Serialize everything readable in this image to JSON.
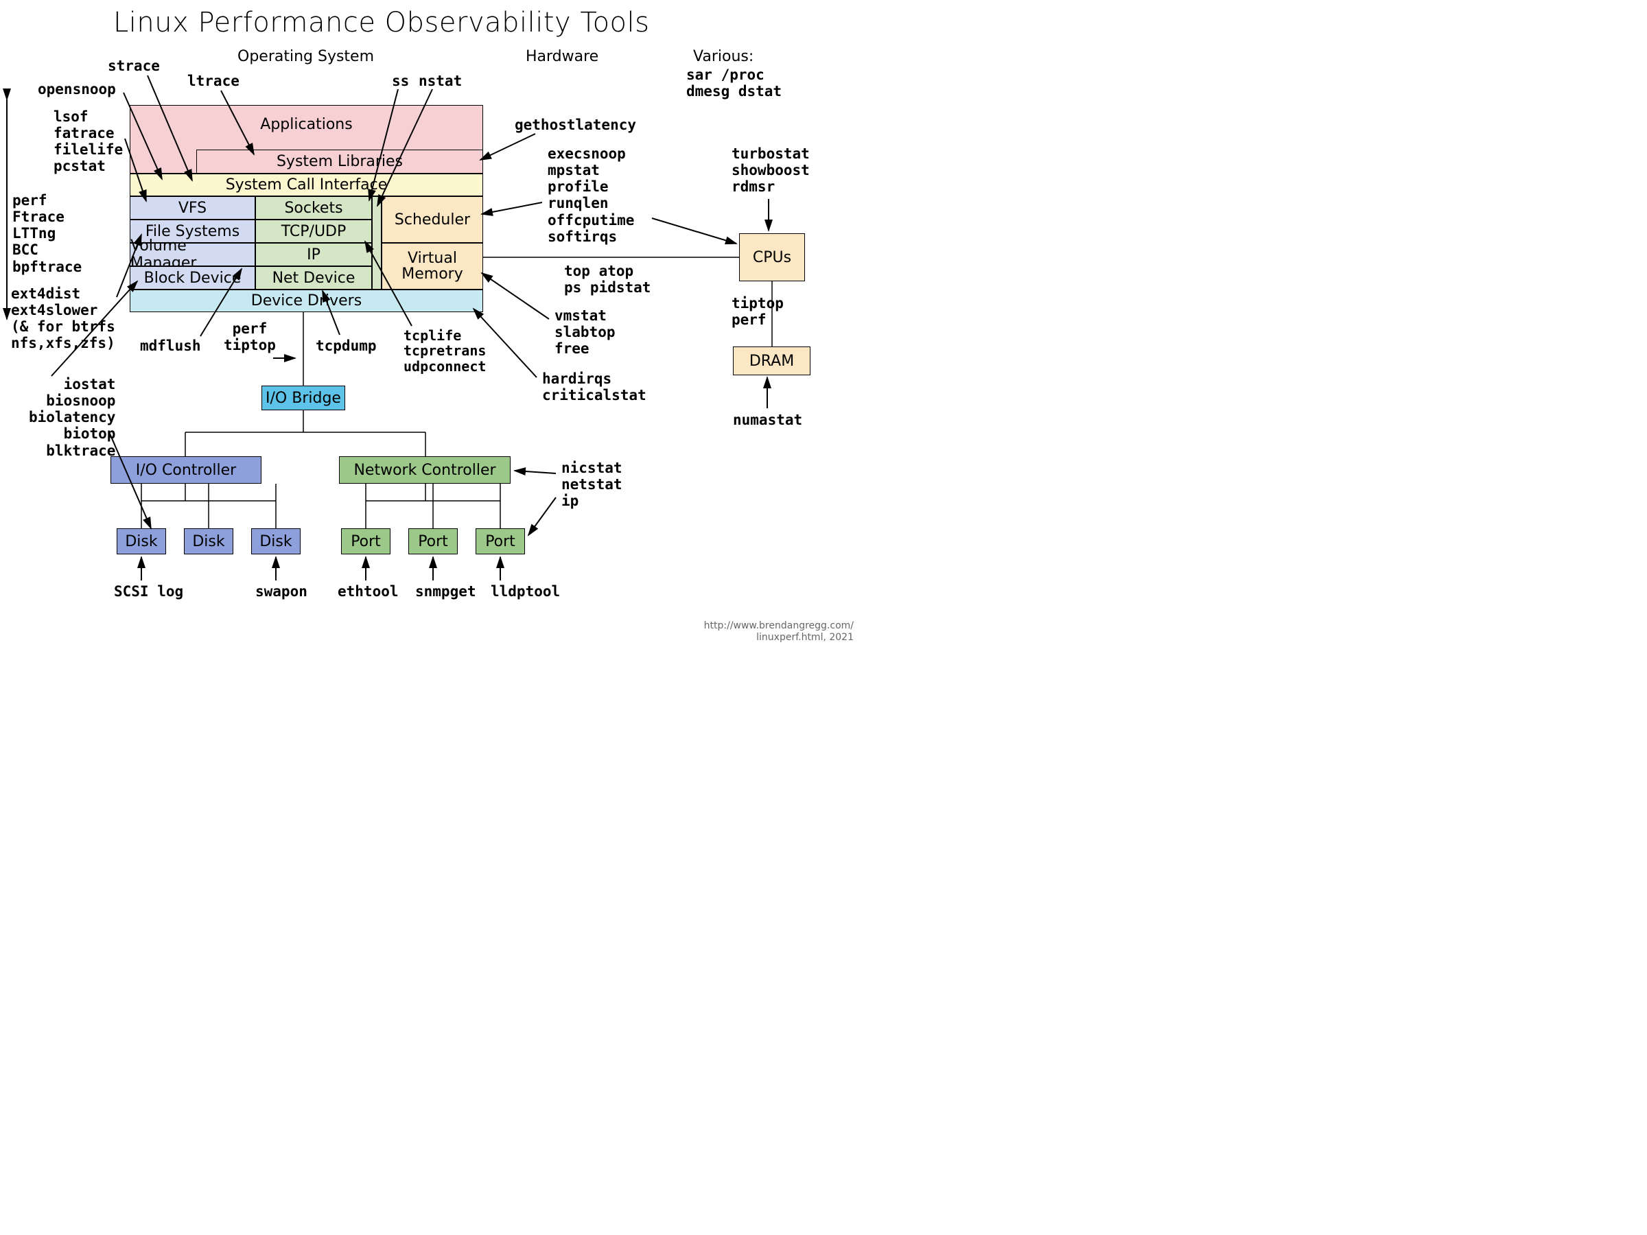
{
  "title": "Linux Performance Observability Tools",
  "sections": {
    "os": "Operating System",
    "hw": "Hardware",
    "var": "Various:"
  },
  "various": {
    "l1": "sar /proc",
    "l2": "dmesg dstat"
  },
  "boxes": {
    "applications": "Applications",
    "syslib": "System Libraries",
    "syscall": "System Call Interface",
    "vfs": "VFS",
    "sockets": "Sockets",
    "fs": "File Systems",
    "tcpudp": "TCP/UDP",
    "volmgr": "Volume Manager",
    "ip": "IP",
    "blockdev": "Block Device",
    "netdev": "Net Device",
    "scheduler": "Scheduler",
    "virtmem_l1": "Virtual",
    "virtmem_l2": "Memory",
    "drivers": "Device Drivers",
    "iobridge": "I/O Bridge",
    "ioctrl": "I/O Controller",
    "netctrl": "Network Controller",
    "disk": "Disk",
    "port": "Port",
    "cpus": "CPUs",
    "dram": "DRAM"
  },
  "tools": {
    "strace": "strace",
    "ltrace": "ltrace",
    "ss": "ss",
    "nstat": "nstat",
    "opensnoop": "opensnoop",
    "lsof_group": "lsof\nfatrace\nfilelife\npcstat",
    "gethostlatency": "gethostlatency",
    "sched_group": "execsnoop\nmpstat\nprofile\nrunqlen\noffcputime\nsoftirqs",
    "turbo_group": "turbostat\nshowboost\nrdmsr",
    "perf_group": "perf\nFtrace\nLTTng\nBCC\nbpftrace",
    "ext4_group": "ext4dist\next4slower\n(& for btrfs\nnfs,xfs,zfs)",
    "top_group": "top atop\nps pidstat",
    "tiptop_group": "tiptop\nperf",
    "numastat": "numastat",
    "vm_group": "vmstat\nslabtop\nfree",
    "hardirq_group": "hardirqs\ncriticalstat",
    "tcp_group": "tcplife\ntcpretrans\nudpconnect",
    "mdflush": "mdflush",
    "perf_tiptop": "perf\ntiptop",
    "tcpdump": "tcpdump",
    "io_group": "iostat\nbiosnoop\nbiolatency\nbiotop\nblktrace",
    "nic_group": "nicstat\nnetstat\nip",
    "scsi": "SCSI log",
    "swapon": "swapon",
    "ethtool": "ethtool",
    "snmpget": "snmpget",
    "lldptool": "lldptool"
  },
  "credit": {
    "l1": "http://www.brendangregg.com/",
    "l2": "linuxperf.html, 2021"
  }
}
